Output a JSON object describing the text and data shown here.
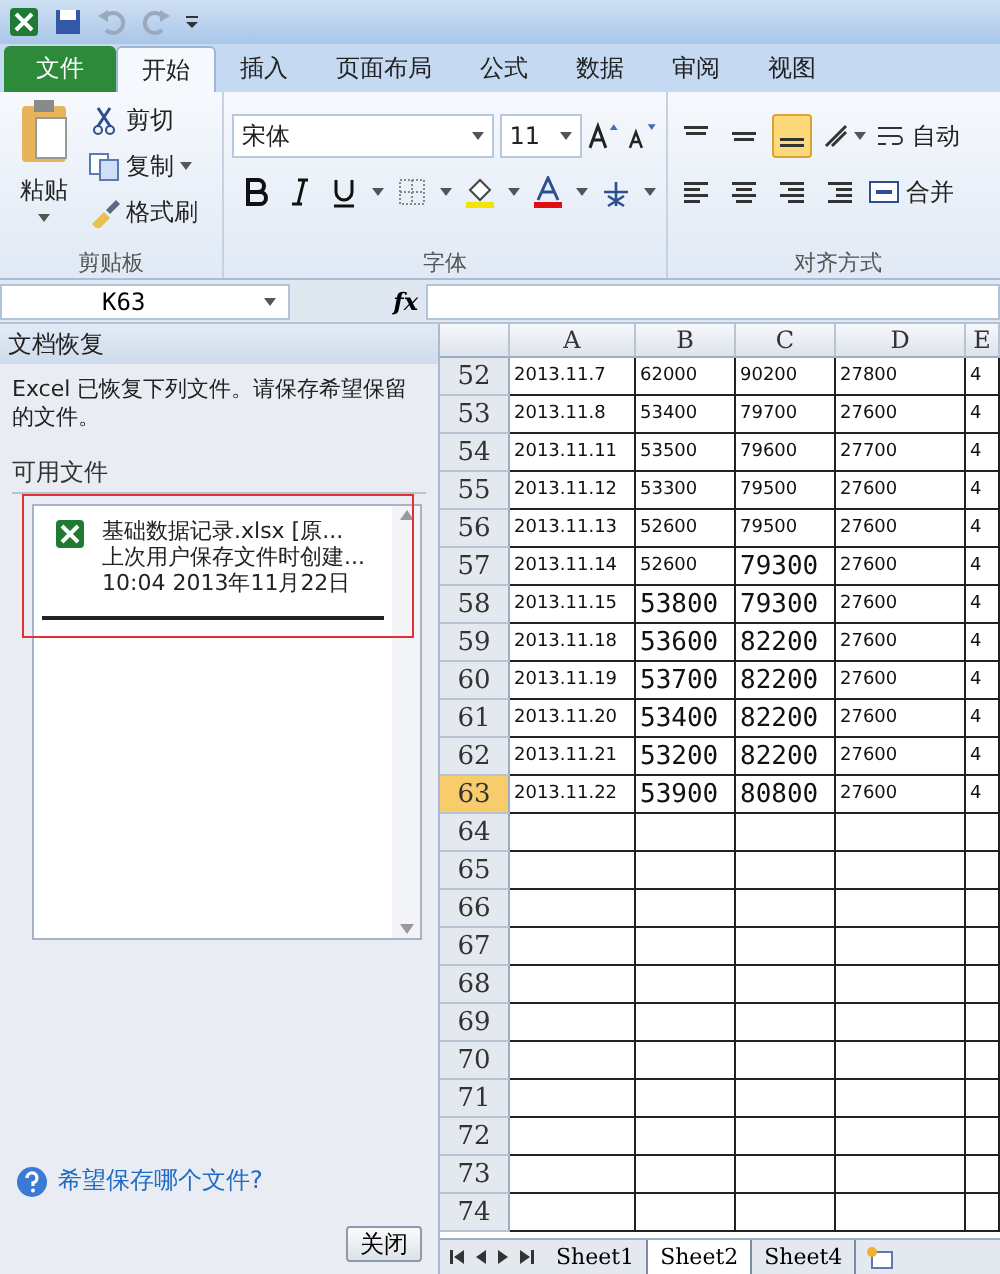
{
  "tabs": [
    {
      "label": "文件",
      "kind": "file",
      "selected": false
    },
    {
      "label": "开始",
      "kind": "tab",
      "selected": true
    },
    {
      "label": "插入",
      "kind": "tab",
      "selected": false
    },
    {
      "label": "页面布局",
      "kind": "tab",
      "selected": false
    },
    {
      "label": "公式",
      "kind": "tab",
      "selected": false
    },
    {
      "label": "数据",
      "kind": "tab",
      "selected": false
    },
    {
      "label": "审阅",
      "kind": "tab",
      "selected": false
    },
    {
      "label": "视图",
      "kind": "tab",
      "selected": false
    }
  ],
  "ribbon": {
    "clipboard": {
      "label": "剪贴板",
      "paste": "粘贴",
      "cut": "剪切",
      "copy": "复制",
      "format_painter": "格式刷"
    },
    "font": {
      "label": "字体",
      "font_name": "宋体",
      "font_size": "11"
    },
    "alignment": {
      "label": "对齐方式",
      "wrap_text": "自动",
      "merge": "合并",
      "bottom_align_selected": true
    }
  },
  "formula_bar": {
    "name_box": "K63",
    "fx": "fx"
  },
  "recovery_pane": {
    "title": "文档恢复",
    "message": "Excel 已恢复下列文件。请保存希望保留的文件。",
    "section": "可用文件",
    "files": [
      {
        "name": "基础数据记录.xlsx  [原...",
        "detail": "上次用户保存文件时创建...",
        "time": "10:04 2013年11月22日",
        "highlighted": true
      }
    ],
    "help_link": "希望保存哪个文件?",
    "close_button": "关闭"
  },
  "sheet": {
    "columns": [
      "A",
      "B",
      "C",
      "D",
      "E"
    ],
    "rows": [
      {
        "header": "52",
        "selected": false,
        "cells": [
          {
            "text": "2013.11.7",
            "kind": "small"
          },
          {
            "text": "62000",
            "kind": "small"
          },
          {
            "text": "90200",
            "kind": "small"
          },
          {
            "text": "27800",
            "kind": "small"
          },
          {
            "text": "4",
            "kind": "small"
          }
        ]
      },
      {
        "header": "53",
        "selected": false,
        "cells": [
          {
            "text": "2013.11.8",
            "kind": "small"
          },
          {
            "text": "53400",
            "kind": "small"
          },
          {
            "text": "79700",
            "kind": "small"
          },
          {
            "text": "27600",
            "kind": "small"
          },
          {
            "text": "4",
            "kind": "small"
          }
        ]
      },
      {
        "header": "54",
        "selected": false,
        "cells": [
          {
            "text": "2013.11.11",
            "kind": "small"
          },
          {
            "text": "53500",
            "kind": "small"
          },
          {
            "text": "79600",
            "kind": "small"
          },
          {
            "text": "27700",
            "kind": "small"
          },
          {
            "text": "4",
            "kind": "small"
          }
        ]
      },
      {
        "header": "55",
        "selected": false,
        "cells": [
          {
            "text": "2013.11.12",
            "kind": "small"
          },
          {
            "text": "53300",
            "kind": "small"
          },
          {
            "text": "79500",
            "kind": "small"
          },
          {
            "text": "27600",
            "kind": "small"
          },
          {
            "text": "4",
            "kind": "small"
          }
        ]
      },
      {
        "header": "56",
        "selected": false,
        "cells": [
          {
            "text": "2013.11.13",
            "kind": "small"
          },
          {
            "text": "52600",
            "kind": "small"
          },
          {
            "text": "79500",
            "kind": "small"
          },
          {
            "text": "27600",
            "kind": "small"
          },
          {
            "text": "4",
            "kind": "small"
          }
        ]
      },
      {
        "header": "57",
        "selected": false,
        "cells": [
          {
            "text": "2013.11.14",
            "kind": "small"
          },
          {
            "text": "52600",
            "kind": "small"
          },
          {
            "text": "79300",
            "kind": "large"
          },
          {
            "text": "27600",
            "kind": "small"
          },
          {
            "text": "4",
            "kind": "small"
          }
        ]
      },
      {
        "header": "58",
        "selected": false,
        "cells": [
          {
            "text": "2013.11.15",
            "kind": "small"
          },
          {
            "text": "53800",
            "kind": "large"
          },
          {
            "text": "79300",
            "kind": "large"
          },
          {
            "text": "27600",
            "kind": "small"
          },
          {
            "text": "4",
            "kind": "small"
          }
        ]
      },
      {
        "header": "59",
        "selected": false,
        "cells": [
          {
            "text": "2013.11.18",
            "kind": "small"
          },
          {
            "text": "53600",
            "kind": "large"
          },
          {
            "text": "82200",
            "kind": "large"
          },
          {
            "text": "27600",
            "kind": "small"
          },
          {
            "text": "4",
            "kind": "small"
          }
        ]
      },
      {
        "header": "60",
        "selected": false,
        "cells": [
          {
            "text": "2013.11.19",
            "kind": "small"
          },
          {
            "text": "53700",
            "kind": "large"
          },
          {
            "text": "82200",
            "kind": "large"
          },
          {
            "text": "27600",
            "kind": "small"
          },
          {
            "text": "4",
            "kind": "small"
          }
        ]
      },
      {
        "header": "61",
        "selected": false,
        "cells": [
          {
            "text": "2013.11.20",
            "kind": "small"
          },
          {
            "text": "53400",
            "kind": "large"
          },
          {
            "text": "82200",
            "kind": "large"
          },
          {
            "text": "27600",
            "kind": "small"
          },
          {
            "text": "4",
            "kind": "small"
          }
        ]
      },
      {
        "header": "62",
        "selected": false,
        "cells": [
          {
            "text": "2013.11.21",
            "kind": "small"
          },
          {
            "text": "53200",
            "kind": "large"
          },
          {
            "text": "82200",
            "kind": "large"
          },
          {
            "text": "27600",
            "kind": "small"
          },
          {
            "text": "4",
            "kind": "small"
          }
        ]
      },
      {
        "header": "63",
        "selected": true,
        "cells": [
          {
            "text": "2013.11.22",
            "kind": "small"
          },
          {
            "text": "53900",
            "kind": "large"
          },
          {
            "text": "80800",
            "kind": "large"
          },
          {
            "text": "27600",
            "kind": "small"
          },
          {
            "text": "4",
            "kind": "small"
          }
        ]
      },
      {
        "header": "64",
        "selected": false,
        "cells": []
      },
      {
        "header": "65",
        "selected": false,
        "cells": []
      },
      {
        "header": "66",
        "selected": false,
        "cells": []
      },
      {
        "header": "67",
        "selected": false,
        "cells": []
      },
      {
        "header": "68",
        "selected": false,
        "cells": []
      },
      {
        "header": "69",
        "selected": false,
        "cells": []
      },
      {
        "header": "70",
        "selected": false,
        "cells": []
      },
      {
        "header": "71",
        "selected": false,
        "cells": []
      },
      {
        "header": "72",
        "selected": false,
        "cells": []
      },
      {
        "header": "73",
        "selected": false,
        "cells": []
      },
      {
        "header": "74",
        "selected": false,
        "cells": []
      }
    ]
  },
  "sheet_tabs": [
    {
      "label": "Sheet1",
      "selected": false
    },
    {
      "label": "Sheet2",
      "selected": true
    },
    {
      "label": "Sheet4",
      "selected": false
    }
  ]
}
